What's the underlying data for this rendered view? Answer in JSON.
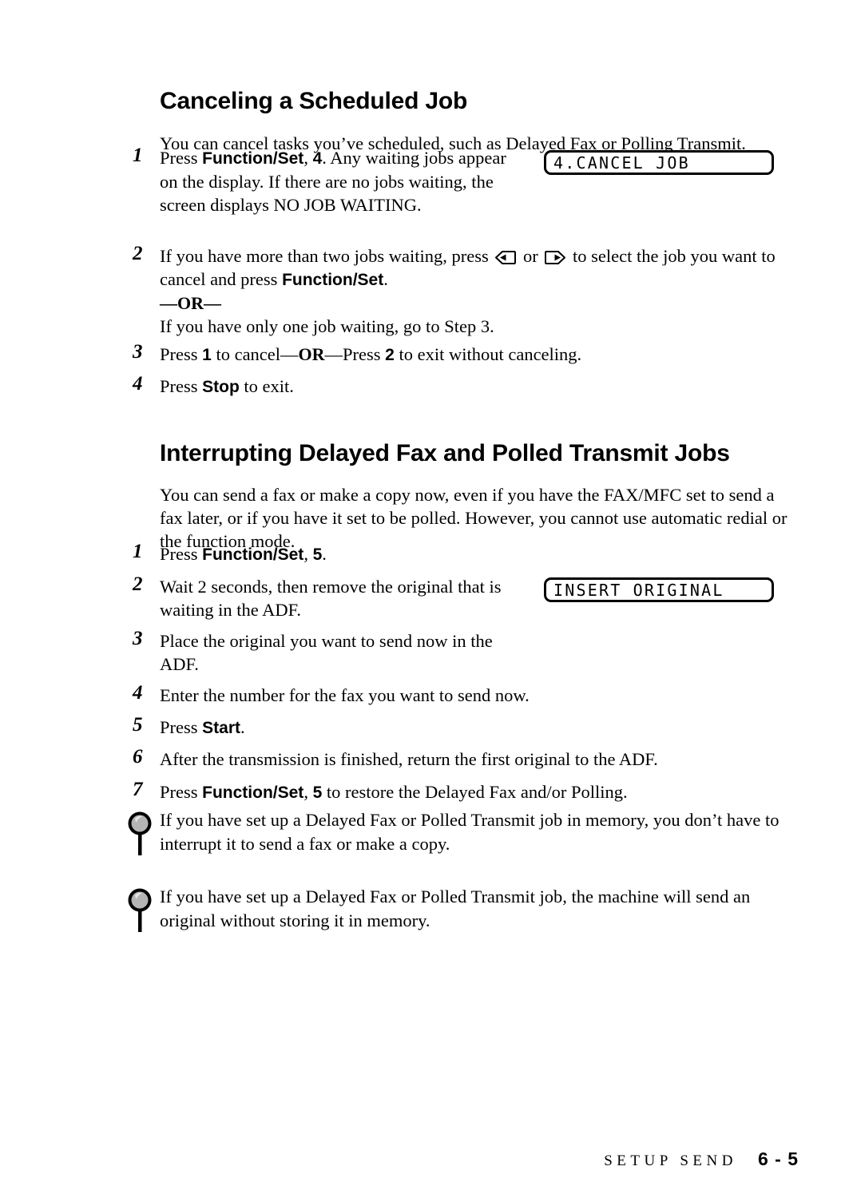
{
  "document": {
    "sections": [
      {
        "heading": "Canceling a Scheduled Job",
        "intro": "You can cancel tasks you’ve scheduled, such as Delayed Fax or Polling Transmit.",
        "steps": [
          {
            "number": "1",
            "text_1": "Press ",
            "bold_1": "Function/Set",
            "text_2": ", ",
            "bold_2": "4",
            "text_3": ". Any waiting jobs appear on the display. If there are no jobs waiting, the screen displays NO JOB WAITING."
          },
          {
            "number": "2",
            "text_1": "If you have more than two jobs waiting, press ",
            "icon_left": "arrow-left-key-icon",
            "text_2": " or ",
            "icon_right": "arrow-right-key-icon",
            "text_3": " to select the job you want to cancel and press ",
            "bold_1": "Function/Set",
            "text_4": ".",
            "or_label": "—OR—",
            "text_5": "If you have only one job waiting, go to Step 3."
          },
          {
            "number": "3",
            "text_1": "Press ",
            "bold_1": "1",
            "text_2": " to cancel—",
            "or_label": "OR",
            "text_3": "—Press ",
            "bold_2": "2",
            "text_4": " to exit without canceling."
          },
          {
            "number": "4",
            "text_1": "Press ",
            "bold_1": "Stop",
            "text_2": " to exit."
          }
        ]
      },
      {
        "heading": "Interrupting Delayed Fax and Polled Transmit Jobs",
        "intro": "You can send a fax or make a copy now, even if you have the FAX/MFC set to send a fax later, or if you have it set to be polled. However, you cannot use automatic redial or the function mode.",
        "steps": [
          {
            "number": "1",
            "text_1": "Press ",
            "bold_1": "Function/Set",
            "text_2": ", ",
            "bold_2": "5",
            "text_3": "."
          },
          {
            "number": "2",
            "text_1": "Wait 2 seconds, then remove the original that is waiting in the ADF."
          },
          {
            "number": "3",
            "text_1": "Place the original you want to send now in the ADF."
          },
          {
            "number": "4",
            "text_1": "Enter the number for the fax you want to send now."
          },
          {
            "number": "5",
            "text_1": "Press ",
            "bold_1": "Start",
            "text_2": "."
          },
          {
            "number": "6",
            "text_1": "After the transmission is finished, return the first original to the ADF."
          },
          {
            "number": "7",
            "text_1": "Press ",
            "bold_1": "Function/Set",
            "text_2": ", ",
            "bold_2": "5",
            "text_3": " to restore the Delayed Fax and/or Polling."
          }
        ]
      }
    ],
    "lcd_displays": [
      {
        "id": "cancel-job",
        "text": "4.CANCEL JOB"
      },
      {
        "id": "insert-original",
        "text": "INSERT ORIGINAL"
      }
    ],
    "notes": [
      {
        "icon": "note-magnifier-icon",
        "text": "If you have set up a Delayed Fax or Polled Transmit job in memory, you don’t have to interrupt it to send a fax or make a copy."
      },
      {
        "icon": "note-magnifier-icon",
        "text": "If you have set up a Delayed Fax or Polled Transmit job, the machine will send an original without storing it in memory."
      }
    ],
    "footer": {
      "chapter_title": "SETUP SEND",
      "page_number": "6 - 5"
    },
    "colors": {
      "text": "#000000",
      "background": "#ffffff",
      "note_icon_fill": "#b5b5b5"
    }
  }
}
